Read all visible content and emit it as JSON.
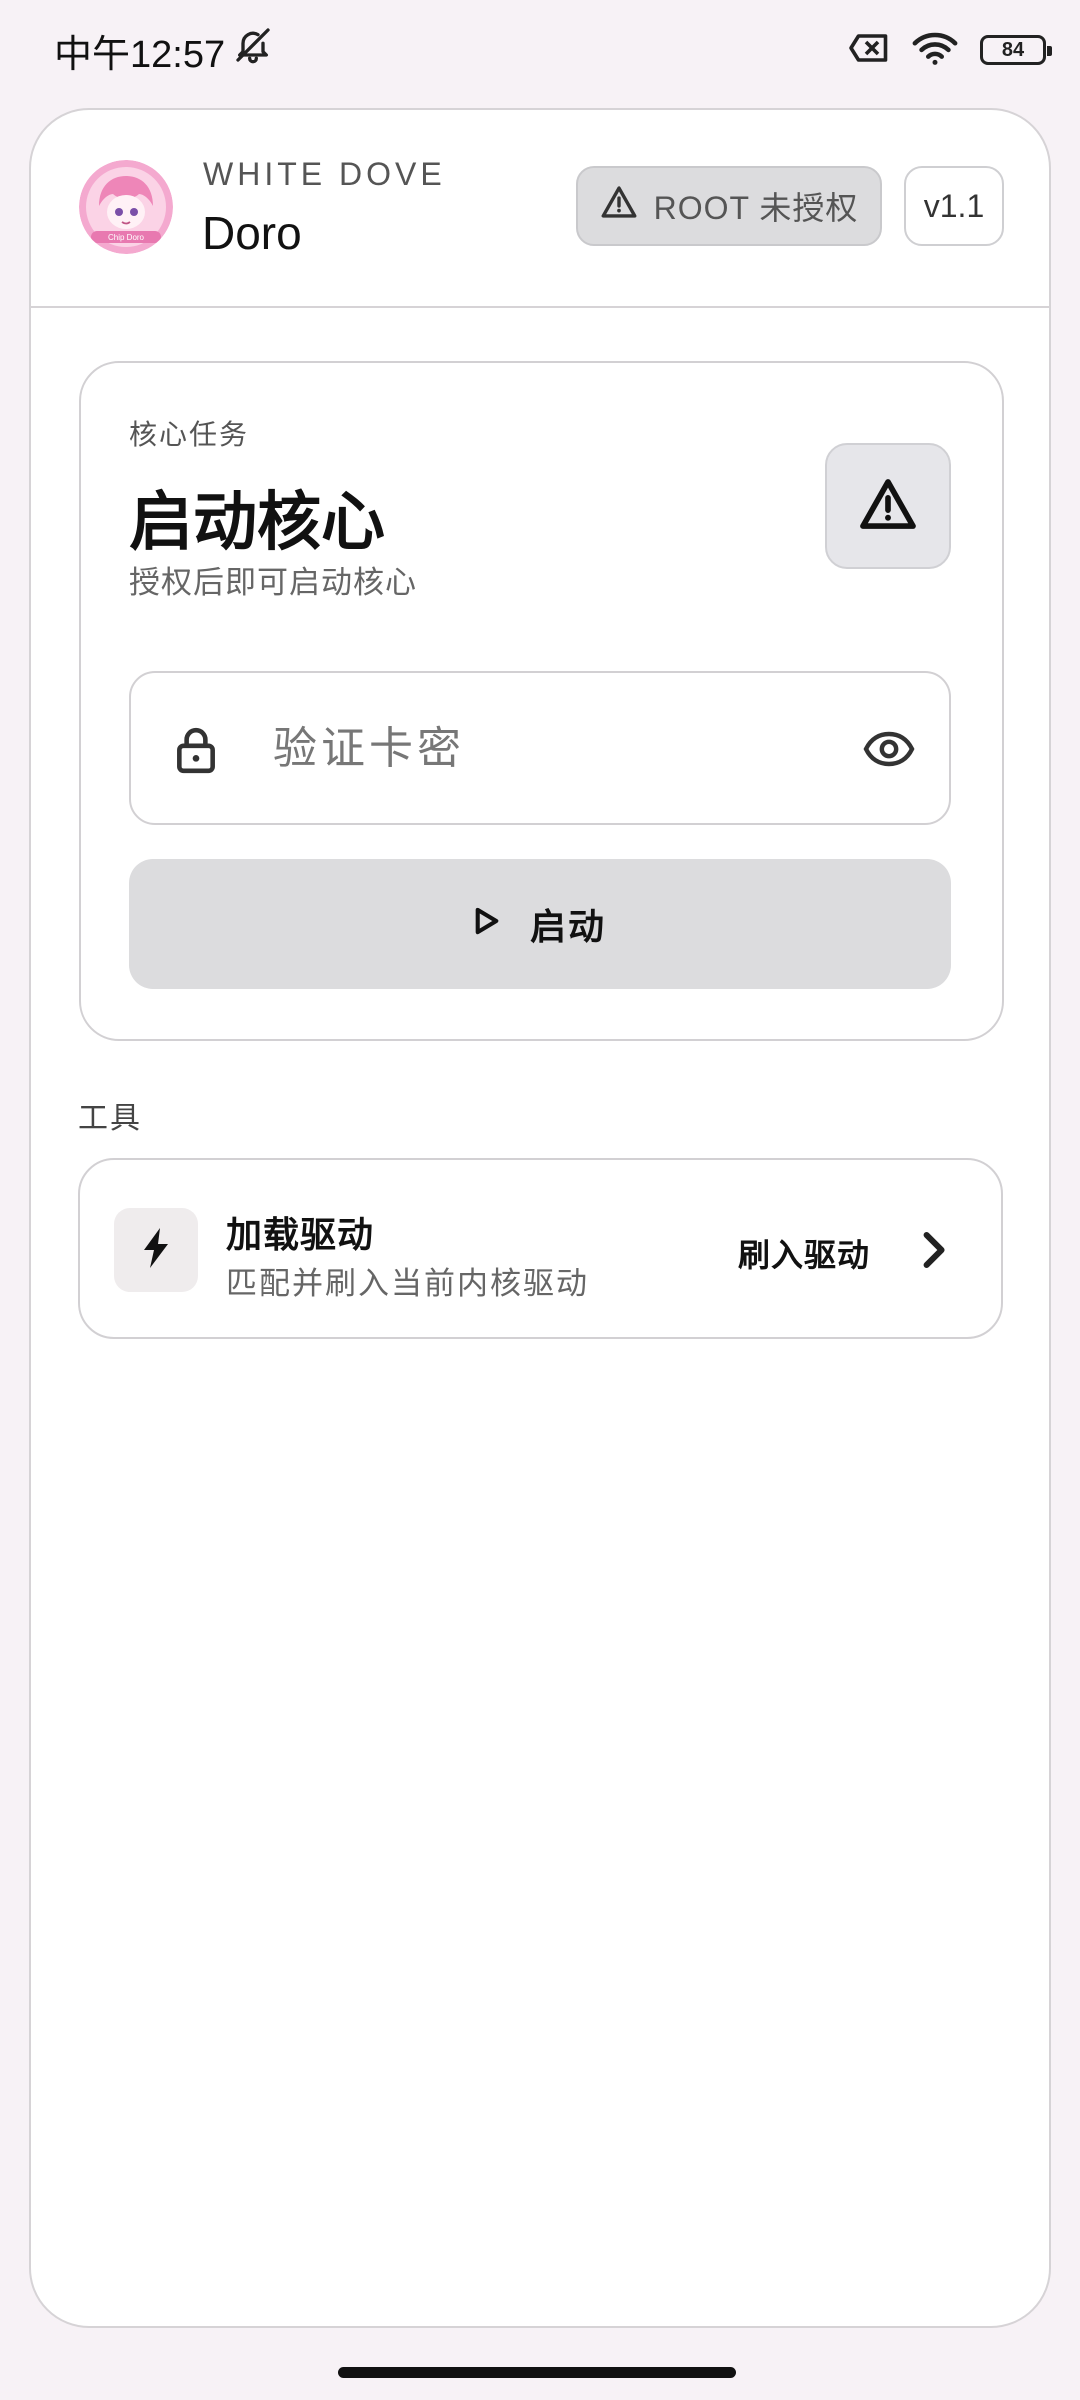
{
  "status_bar": {
    "time": "中午12:57",
    "battery": "84",
    "icons": [
      "bell-off-icon",
      "sim-x-icon",
      "wifi-icon",
      "battery-icon"
    ]
  },
  "header": {
    "avatar_text": "Chip Doro",
    "brand_sub": "WHITE DOVE",
    "brand_title": "Doro",
    "root_badge": "ROOT 未授权",
    "version": "v1.1"
  },
  "task_card": {
    "label": "核心任务",
    "title": "启动核心",
    "description": "授权后即可启动核心",
    "input_placeholder": "验证卡密",
    "input_value": "",
    "start_label": "启动"
  },
  "tools": {
    "section_title": "工具",
    "items": [
      {
        "title": "加载驱动",
        "description": "匹配并刷入当前内核驱动",
        "action": "刷入驱动"
      }
    ]
  },
  "colors": {
    "background": "#f7f2f6",
    "card": "#ffffff",
    "border": "#d2d0d3",
    "badge_gray": "#dcdcde",
    "avatar_pink": "#f4a9cf"
  }
}
